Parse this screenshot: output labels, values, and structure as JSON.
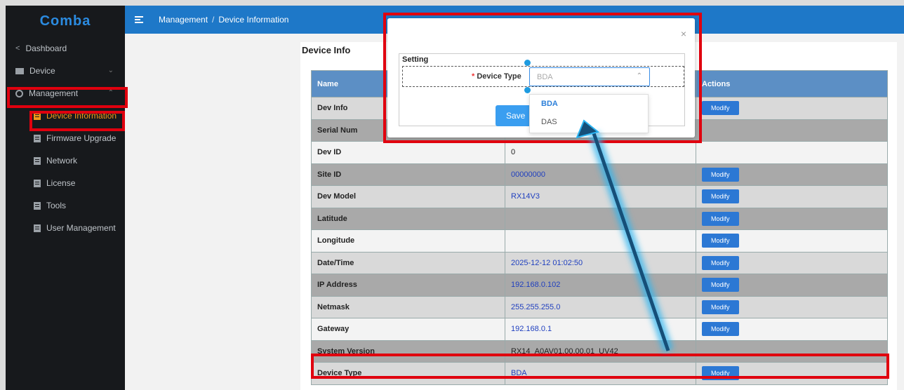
{
  "app": {
    "logo": "Comba"
  },
  "sidebar": {
    "items": [
      {
        "label": "Dashboard",
        "icon": "share-icon"
      },
      {
        "label": "Device",
        "icon": "monitor-icon"
      },
      {
        "label": "Management",
        "icon": "gear-icon"
      }
    ],
    "subitems": [
      {
        "label": "Device Information",
        "active": true
      },
      {
        "label": "Firmware Upgrade"
      },
      {
        "label": "Network"
      },
      {
        "label": "License"
      },
      {
        "label": "Tools"
      },
      {
        "label": "User Management"
      }
    ]
  },
  "header": {
    "breadcrumb": [
      "Management",
      "Device Information"
    ],
    "separator": "/"
  },
  "main": {
    "title": "Device Info",
    "columns": [
      "Name",
      "Actions"
    ],
    "modify_label": "Modify",
    "rows": [
      {
        "name": "Dev Info",
        "value": "",
        "modify": true
      },
      {
        "name": "Serial Num",
        "value": "",
        "modify": false
      },
      {
        "name": "Dev ID",
        "value": "0",
        "modify": false
      },
      {
        "name": "Site ID",
        "value": "00000000",
        "modify": true
      },
      {
        "name": "Dev Model",
        "value": "RX14V3",
        "modify": true
      },
      {
        "name": "Latitude",
        "value": "",
        "modify": true
      },
      {
        "name": "Longitude",
        "value": "",
        "modify": true
      },
      {
        "name": "Date/Time",
        "value": "2025-12-12 01:02:50",
        "modify": true
      },
      {
        "name": "IP Address",
        "value": "192.168.0.102",
        "modify": true
      },
      {
        "name": "Netmask",
        "value": "255.255.255.0",
        "modify": true
      },
      {
        "name": "Gateway",
        "value": "192.168.0.1",
        "modify": true
      },
      {
        "name": "System Version",
        "value": "RX14_A0AV01.00.00.01_UV42",
        "modify": false
      },
      {
        "name": "Device Type",
        "value": "BDA",
        "modify": true
      }
    ]
  },
  "modal": {
    "close": "×",
    "section": "Setting",
    "field_required": "*",
    "field_label": "Device Type",
    "placeholder": "BDA",
    "save": "Save",
    "options": [
      "BDA",
      "DAS"
    ]
  },
  "colors": {
    "header": "#1e78c8",
    "sidebar": "#17191c",
    "active": "#f29a19",
    "annotation": "#e0000e",
    "arrow": "#1e9be0"
  }
}
